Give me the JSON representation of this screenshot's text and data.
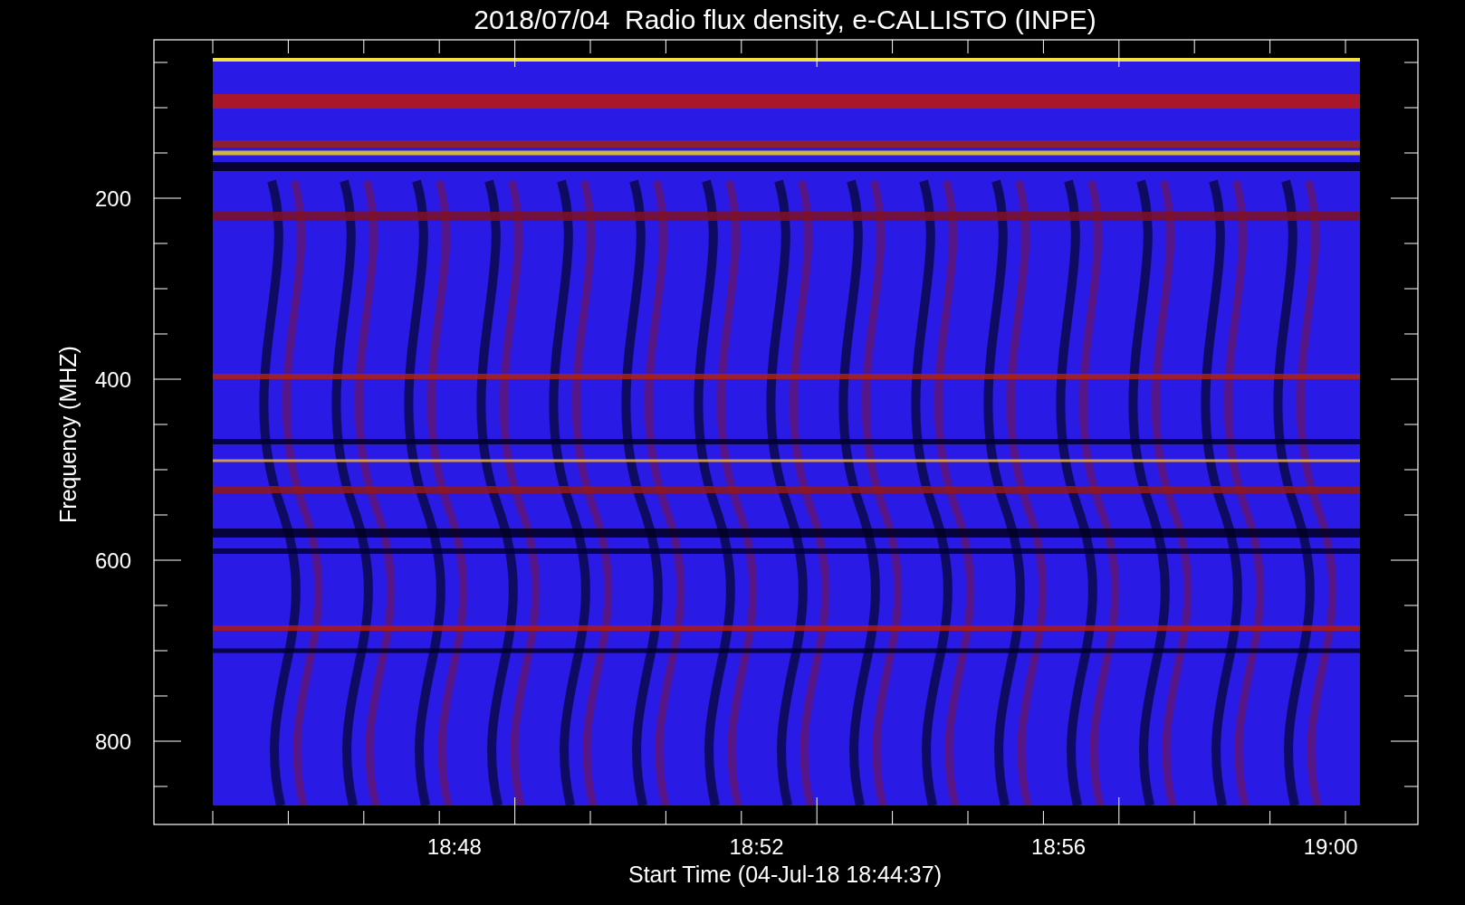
{
  "title": "2018/07/04  Radio flux density, e-CALLISTO (INPE)",
  "y_axis": {
    "label": "Frequency (MHZ)",
    "ticks": [
      "200",
      "400",
      "600",
      "800"
    ]
  },
  "x_axis": {
    "label": "Start Time (04-Jul-18 18:44:37)",
    "ticks": [
      "18:48",
      "18:52",
      "18:56",
      "19:00"
    ]
  }
}
